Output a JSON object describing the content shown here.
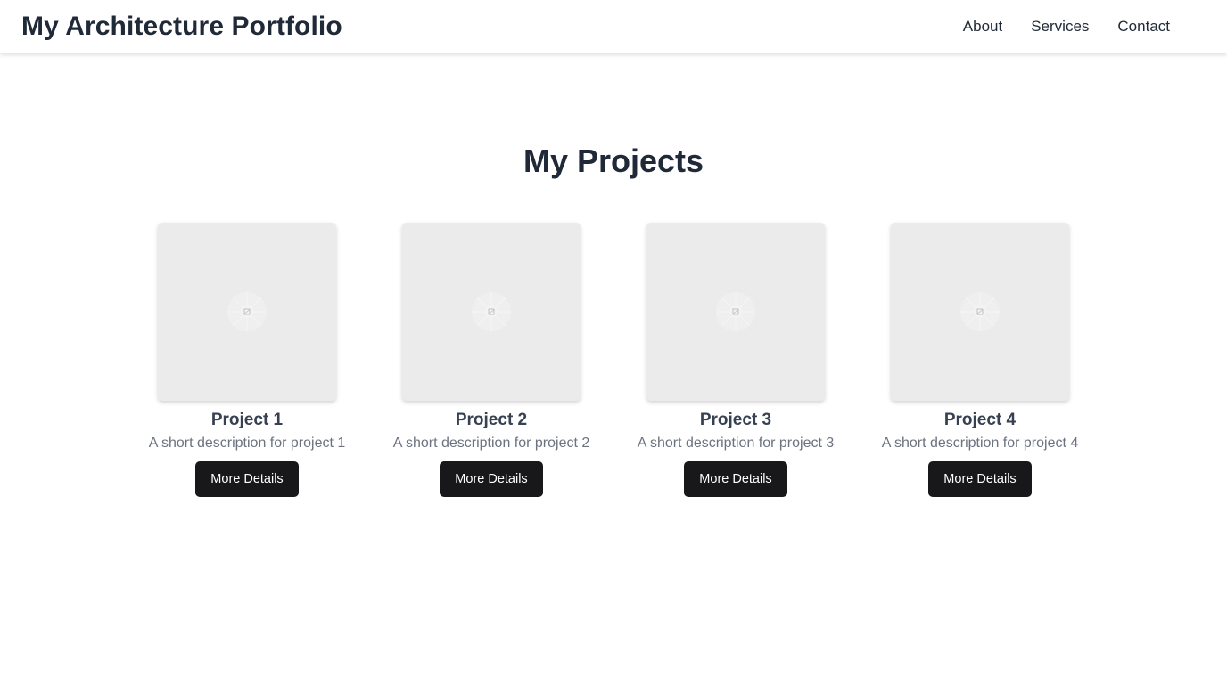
{
  "header": {
    "title": "My Architecture Portfolio",
    "nav": [
      "About",
      "Services",
      "Contact"
    ]
  },
  "main": {
    "heading": "My Projects",
    "projects": [
      {
        "title": "Project 1",
        "description": "A short description for project 1",
        "button": "More Details",
        "image_icon": "image-placeholder-icon"
      },
      {
        "title": "Project 2",
        "description": "A short description for project 2",
        "button": "More Details",
        "image_icon": "image-placeholder-icon"
      },
      {
        "title": "Project 3",
        "description": "A short description for project 3",
        "button": "More Details",
        "image_icon": "image-placeholder-icon"
      },
      {
        "title": "Project 4",
        "description": "A short description for project 4",
        "button": "More Details",
        "image_icon": "image-placeholder-icon"
      }
    ]
  },
  "colors": {
    "text": "#1f2937",
    "muted": "#6b7280",
    "button_bg": "#18181b",
    "placeholder_bg": "#ebebeb"
  }
}
